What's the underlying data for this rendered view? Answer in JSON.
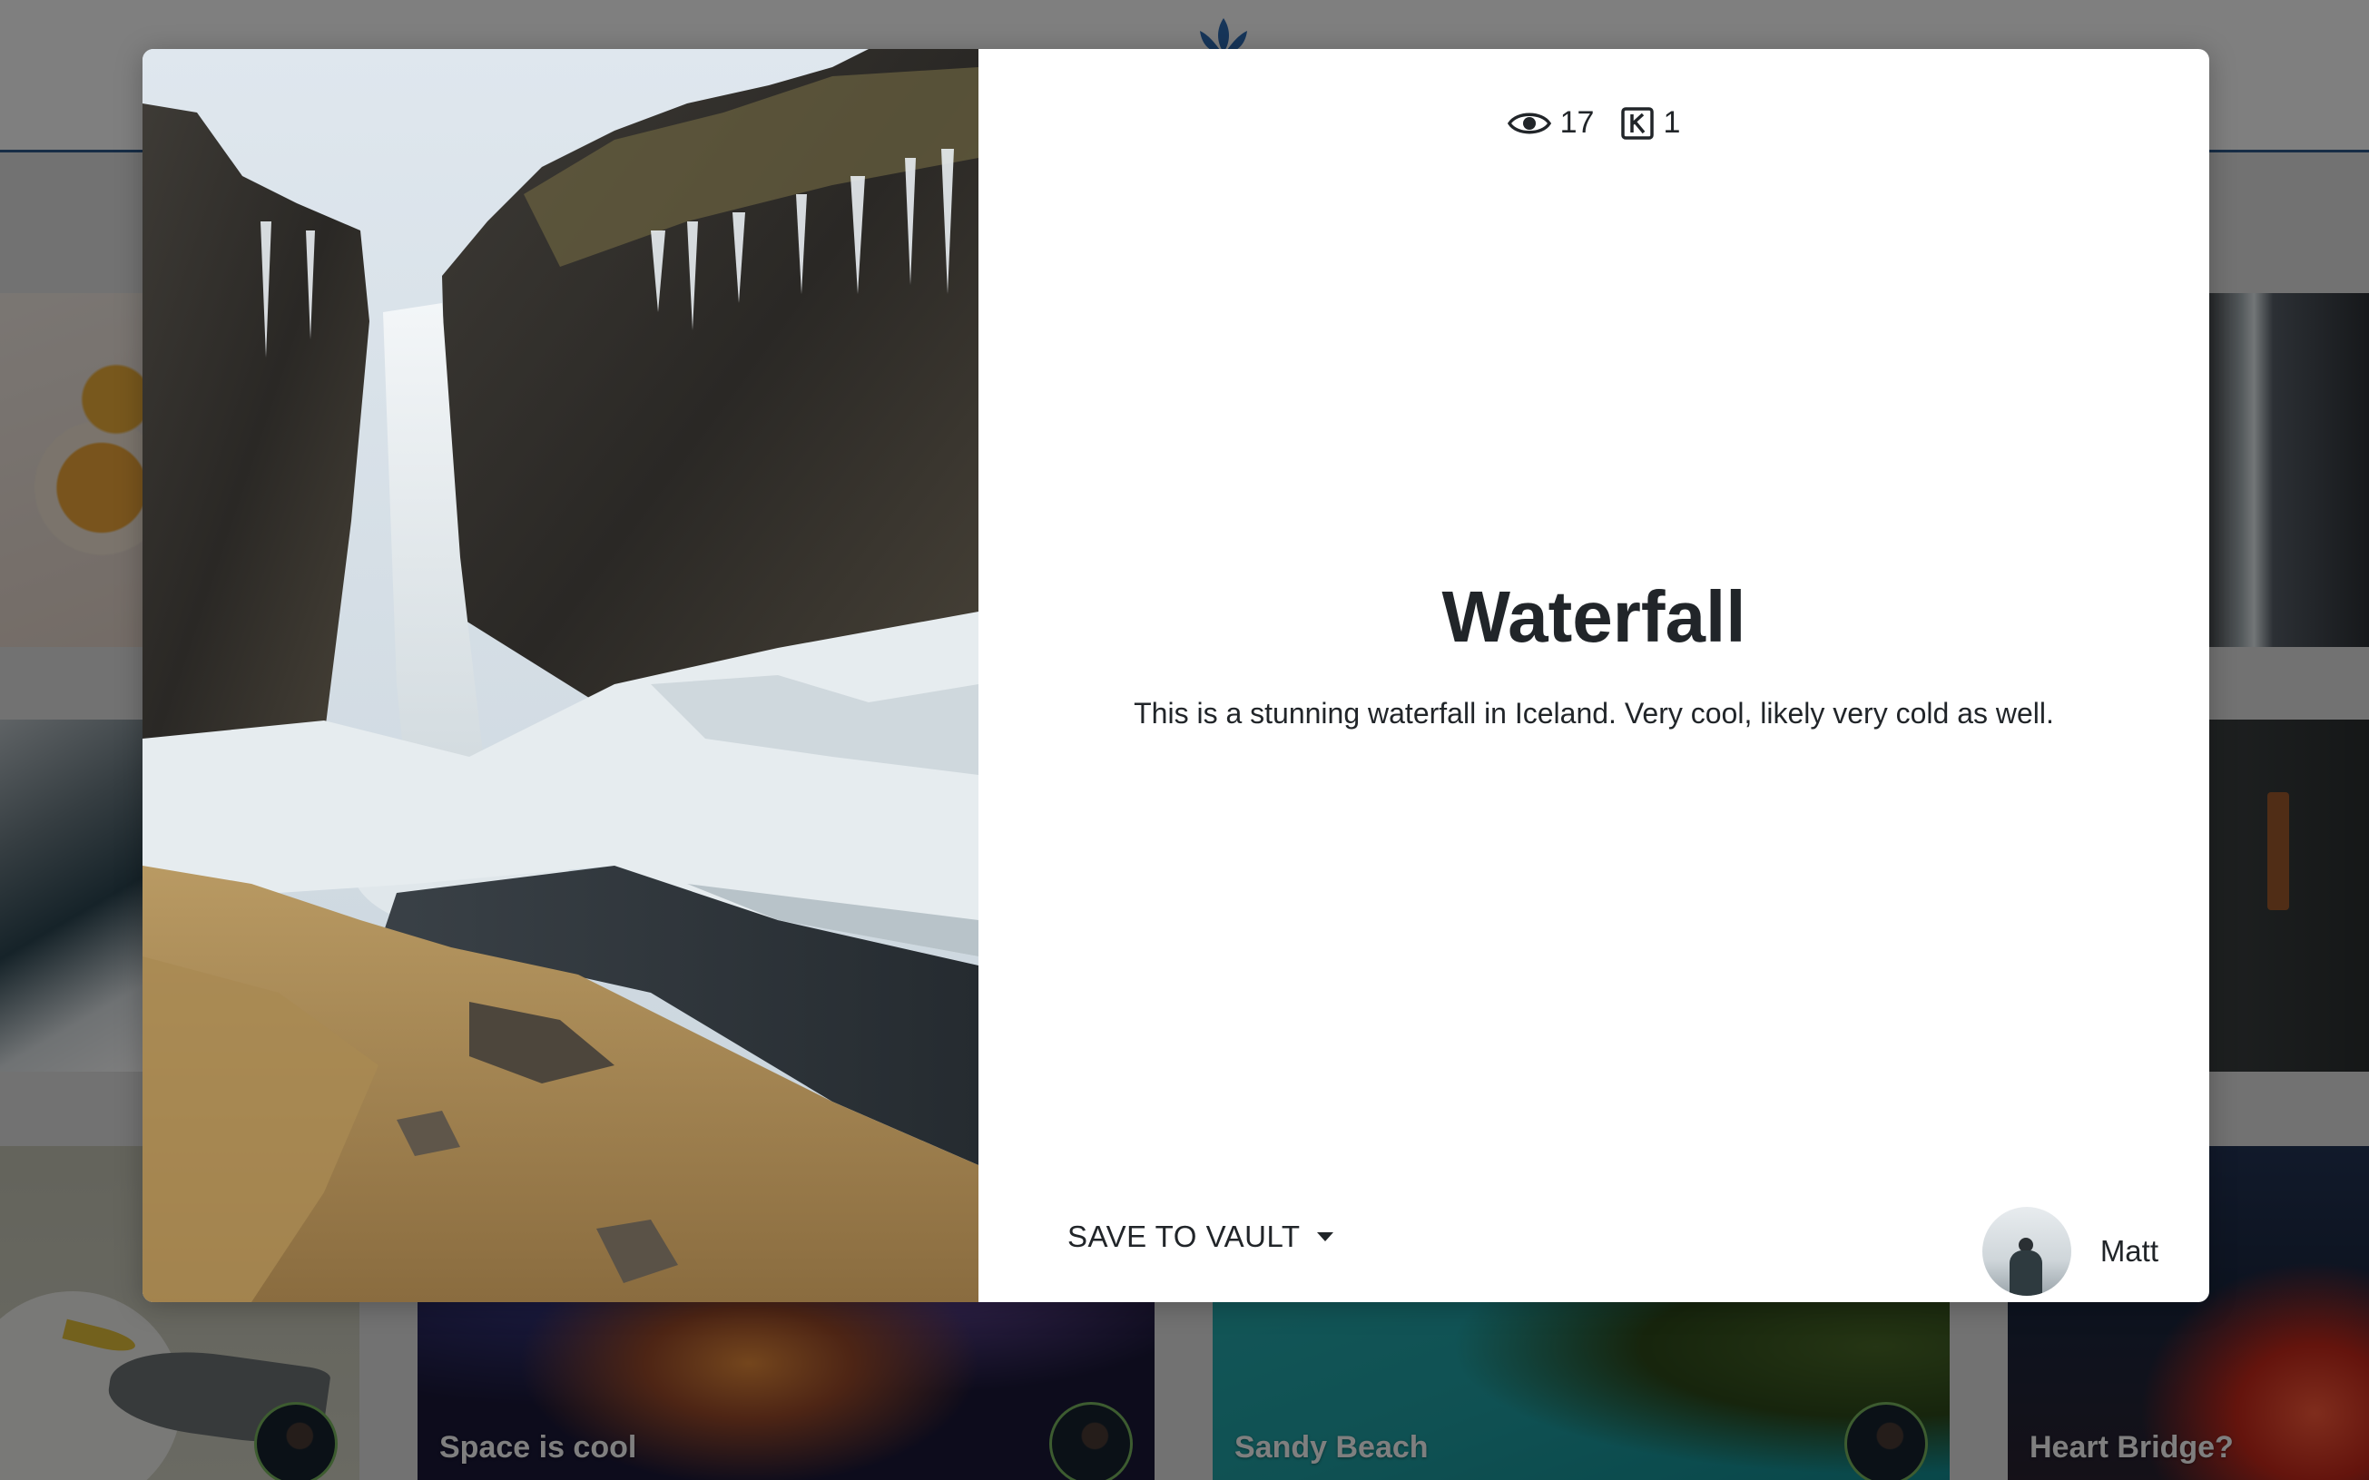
{
  "background": {
    "tiles": [
      {
        "label": "Space is cool"
      },
      {
        "label": "Sandy Beach"
      },
      {
        "label": "Heart Bridge?"
      }
    ]
  },
  "modal": {
    "stats": {
      "views": "17",
      "vault_count": "1",
      "views_icon": "eye-icon",
      "vault_icon": "k-square-icon"
    },
    "title": "Waterfall",
    "description": "This is a stunning waterfall in Iceland. Very cool, likely very cold as well.",
    "save_button_label": "SAVE TO VAULT",
    "author": {
      "name": "Matt"
    }
  }
}
